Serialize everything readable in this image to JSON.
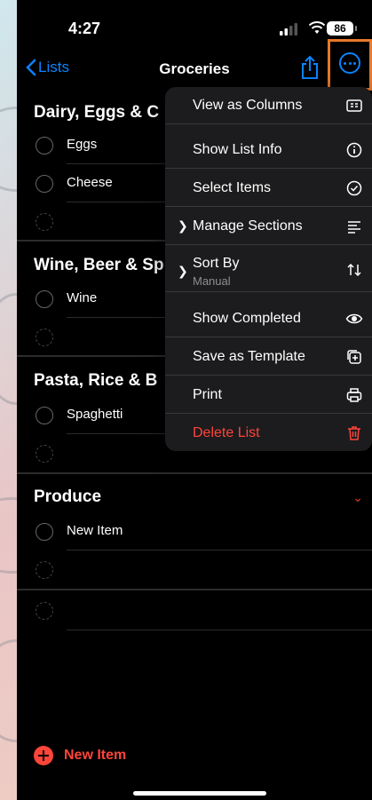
{
  "status": {
    "time": "4:27",
    "battery": "86"
  },
  "nav": {
    "back_label": "Lists",
    "title": "Groceries"
  },
  "sections": [
    {
      "title": "Dairy, Eggs & C",
      "items": [
        "Eggs",
        "Cheese"
      ]
    },
    {
      "title": "Wine, Beer & Sp",
      "items": [
        "Wine"
      ]
    },
    {
      "title": "Pasta, Rice & B",
      "items": [
        "Spaghetti"
      ]
    },
    {
      "title": "Produce",
      "items": [
        "New Item"
      ]
    }
  ],
  "menu": {
    "view_columns": "View as Columns",
    "show_info": "Show List Info",
    "select_items": "Select Items",
    "manage_sections": "Manage Sections",
    "sort_by": "Sort By",
    "sort_by_value": "Manual",
    "show_completed": "Show Completed",
    "save_template": "Save as Template",
    "print": "Print",
    "delete_list": "Delete List"
  },
  "footer": {
    "new_item_label": "New Item"
  },
  "colors": {
    "accent": "#0a84ff",
    "destructive": "#ff453a",
    "highlight": "#e8782a"
  }
}
